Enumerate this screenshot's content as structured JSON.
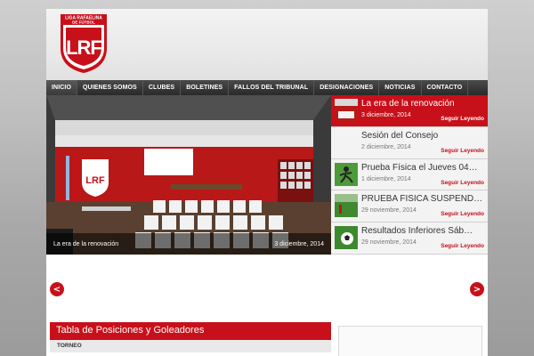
{
  "logo": {
    "line1": "LIGA RAFAELINA",
    "line2": "DE FÚTBOL",
    "letters": "LRF"
  },
  "nav": {
    "items": [
      {
        "label": "INICIO"
      },
      {
        "label": "QUIENES SOMOS"
      },
      {
        "label": "CLUBES"
      },
      {
        "label": "BOLETINES"
      },
      {
        "label": "FALLOS DEL TRIBUNAL"
      },
      {
        "label": "DESIGNACIONES"
      },
      {
        "label": "NOTICIAS"
      },
      {
        "label": "CONTACTO"
      }
    ]
  },
  "slide": {
    "caption": "La era de la renovación",
    "date": "3 diciembre, 2014"
  },
  "news": [
    {
      "title": "La era de la renovación",
      "date": "3 diciembre, 2014",
      "more": "Seguir Leyendo",
      "thumb": "meeting-room"
    },
    {
      "title": "Sesión del Consejo",
      "date": "2 diciembre, 2014",
      "more": "Seguir Leyendo",
      "thumb": "none"
    },
    {
      "title": "Prueba Física el Jueves 04…",
      "date": "1 diciembre, 2014",
      "more": "Seguir Leyendo",
      "thumb": "runner"
    },
    {
      "title": "PRUEBA FISICA SUSPEND…",
      "date": "29 noviembre, 2014",
      "more": "Seguir Leyendo",
      "thumb": "field"
    },
    {
      "title": "Resultados Inferiores Sáb…",
      "date": "29 noviembre, 2014",
      "more": "Seguir Leyendo",
      "thumb": "ball"
    }
  ],
  "carousel": {
    "prev": "<",
    "next": ">"
  },
  "table": {
    "title": "Tabla de Posiciones y Goleadores",
    "column": "TORNEO"
  },
  "colors": {
    "brand": "#c8101a",
    "nav": "#2f2f2f"
  }
}
